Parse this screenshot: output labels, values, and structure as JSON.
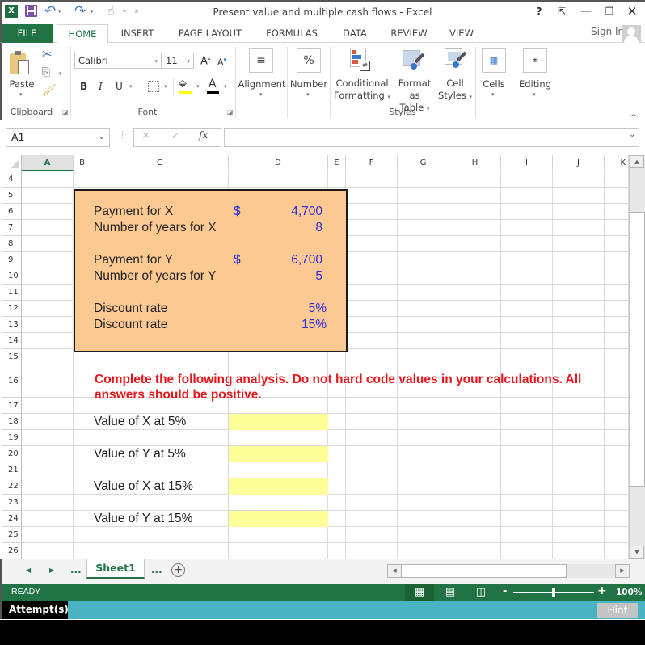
{
  "window": {
    "title": "Present value and multiple cash flows - Excel",
    "help": "?",
    "buttons": {
      "ribbon_display": "⇱",
      "minimize": "—",
      "restore": "❐",
      "close": "✕"
    }
  },
  "quick_access": {
    "app_icon": "X",
    "undo": "↶",
    "redo": "↷",
    "touch": "☝",
    "customize": "⩡"
  },
  "tabs": [
    {
      "label": "FILE"
    },
    {
      "label": "HOME"
    },
    {
      "label": "INSERT"
    },
    {
      "label": "PAGE LAYOUT"
    },
    {
      "label": "FORMULAS"
    },
    {
      "label": "DATA"
    },
    {
      "label": "REVIEW"
    },
    {
      "label": "VIEW"
    }
  ],
  "active_tab": "HOME",
  "sign_in": "Sign In",
  "ribbon": {
    "clipboard": {
      "label": "Clipboard",
      "paste": "Paste"
    },
    "font": {
      "label": "Font",
      "name": "Calibri",
      "size": "11",
      "grow": "A",
      "shrink": "A",
      "bold": "B",
      "italic": "I",
      "underline": "U",
      "fill_color": "#ffff00",
      "font_color": "#000000"
    },
    "alignment": {
      "label": "Alignment",
      "icon": "≡"
    },
    "number": {
      "label": "Number",
      "icon": "%"
    },
    "styles": {
      "label": "Styles",
      "conditional": [
        "Conditional",
        "Formatting"
      ],
      "format_table": [
        "Format as",
        "Table"
      ],
      "cell_styles": [
        "Cell",
        "Styles"
      ]
    },
    "cells": {
      "label": "Cells"
    },
    "editing": {
      "label": "Editing"
    }
  },
  "formula_bar": {
    "name_box": "A1",
    "cancel": "✕",
    "enter": "✓",
    "fx": "fx",
    "value": ""
  },
  "columns": [
    "A",
    "B",
    "C",
    "D",
    "E",
    "F",
    "G",
    "H",
    "I",
    "J",
    "K"
  ],
  "selected_column": "A",
  "rows": [
    "4",
    "5",
    "6",
    "7",
    "8",
    "9",
    "10",
    "11",
    "12",
    "13",
    "14",
    "15",
    "16",
    "17",
    "18",
    "19",
    "20",
    "21",
    "22",
    "23",
    "24",
    "25",
    "26"
  ],
  "inputs": [
    {
      "label": "Payment for X",
      "currency": "$",
      "value": "4,700"
    },
    {
      "label": "Number of years for X",
      "currency": "",
      "value": "8"
    },
    {
      "label": "Payment for Y",
      "currency": "$",
      "value": "6,700"
    },
    {
      "label": "Number of years for Y",
      "currency": "",
      "value": "5"
    },
    {
      "label": "Discount rate",
      "currency": "",
      "value": "5%"
    },
    {
      "label": "Discount rate",
      "currency": "",
      "value": "15%"
    }
  ],
  "instruction": "Complete the following analysis. Do not hard code values in your calculations. All answers should be positive.",
  "instruction_lines": [
    "Complete the following analysis. Do not hard code values in your calculations. All",
    "answers should be positive."
  ],
  "answers": [
    {
      "label": "Value of X at 5%",
      "value": ""
    },
    {
      "label": "Value of Y at 5%",
      "value": ""
    },
    {
      "label": "Value of X at 15%",
      "value": ""
    },
    {
      "label": "Value of Y at 15%",
      "value": ""
    }
  ],
  "colors": {
    "input_fill": "#fcc992",
    "answer_fill": "#ffff99",
    "instruction": "#e8161c",
    "input_value": "#2b2bd9",
    "excel_green": "#217346"
  },
  "sheets": {
    "ellipsis_left": "...",
    "active": "Sheet1",
    "ellipsis_right": "...",
    "add": "+"
  },
  "status": {
    "ready": "READY",
    "zoom": "100%",
    "zoom_minus": "-",
    "zoom_plus": "+",
    "zoom_fraction": 0.5
  },
  "footer": {
    "attempts": "Attempt(s)",
    "hint": "Hint"
  }
}
